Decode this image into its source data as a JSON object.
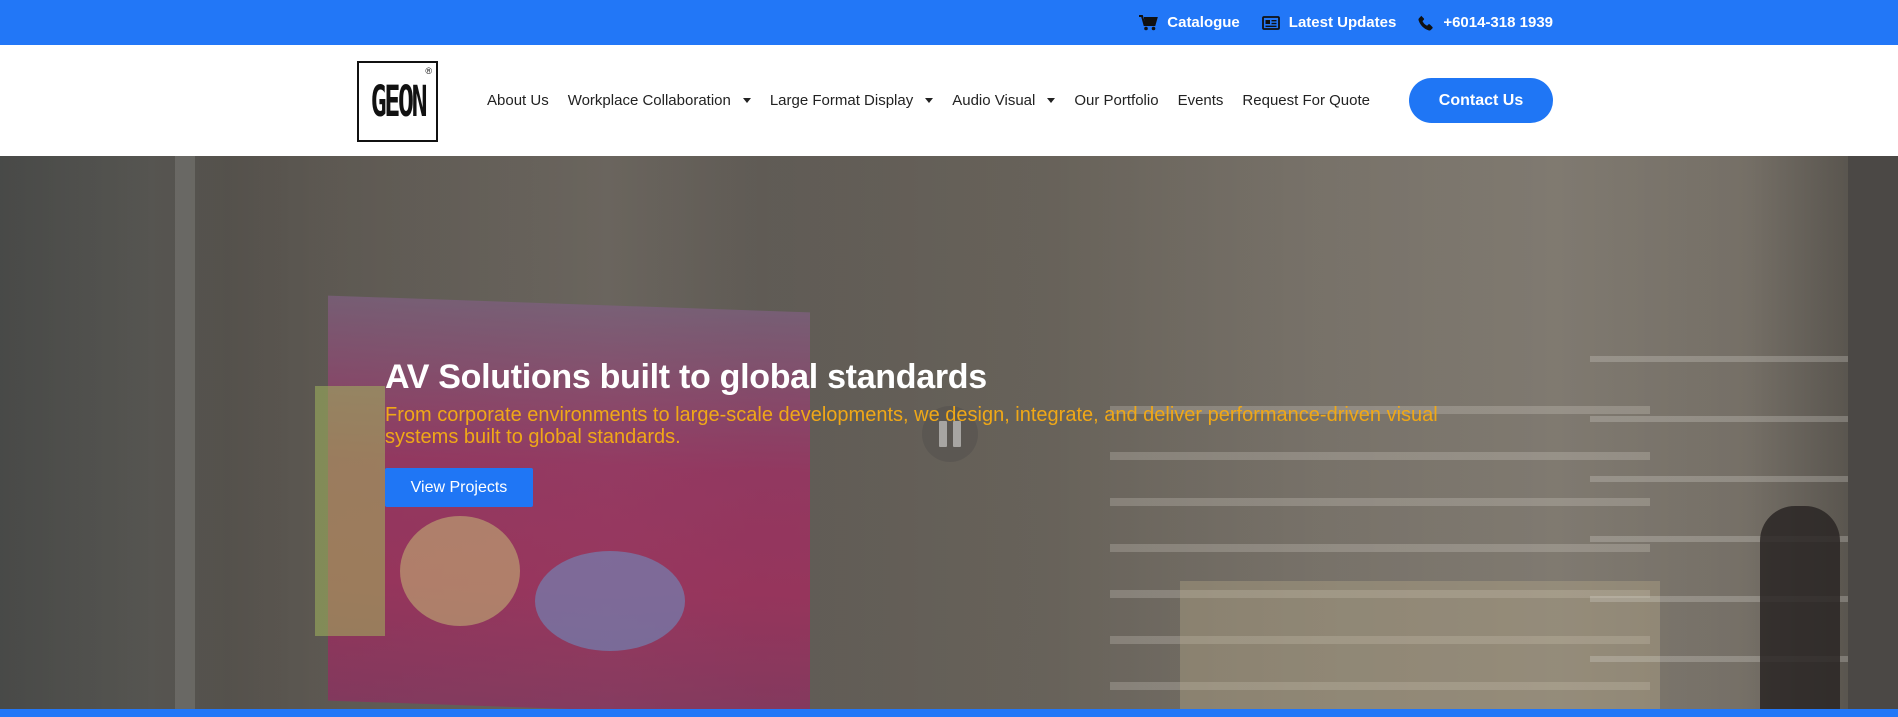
{
  "colors": {
    "brand_blue": "#2277f7",
    "accent_orange": "#f0a817",
    "nav_text": "#222222"
  },
  "topbar": {
    "links": [
      {
        "label": "Catalogue",
        "icon": "cart-icon"
      },
      {
        "label": "Latest Updates",
        "icon": "newspaper-icon"
      },
      {
        "label": "+6014-318 1939",
        "icon": "phone-icon"
      }
    ]
  },
  "header": {
    "logo_text": "GEON",
    "logo_mark": "®",
    "nav": [
      {
        "label": "About Us",
        "has_dropdown": false
      },
      {
        "label": "Workplace Collaboration",
        "has_dropdown": true
      },
      {
        "label": "Large Format Display",
        "has_dropdown": true
      },
      {
        "label": "Audio Visual",
        "has_dropdown": true
      },
      {
        "label": "Our Portfolio",
        "has_dropdown": false
      },
      {
        "label": "Events",
        "has_dropdown": false
      },
      {
        "label": "Request For Quote",
        "has_dropdown": false
      }
    ],
    "contact_label": "Contact Us"
  },
  "hero": {
    "title": "AV Solutions built to global standards",
    "subtitle": "From corporate environments to large-scale developments, we design, integrate, and deliver performance-driven visual systems built to global standards.",
    "button_label": "View Projects",
    "video_control": "pause-icon"
  }
}
